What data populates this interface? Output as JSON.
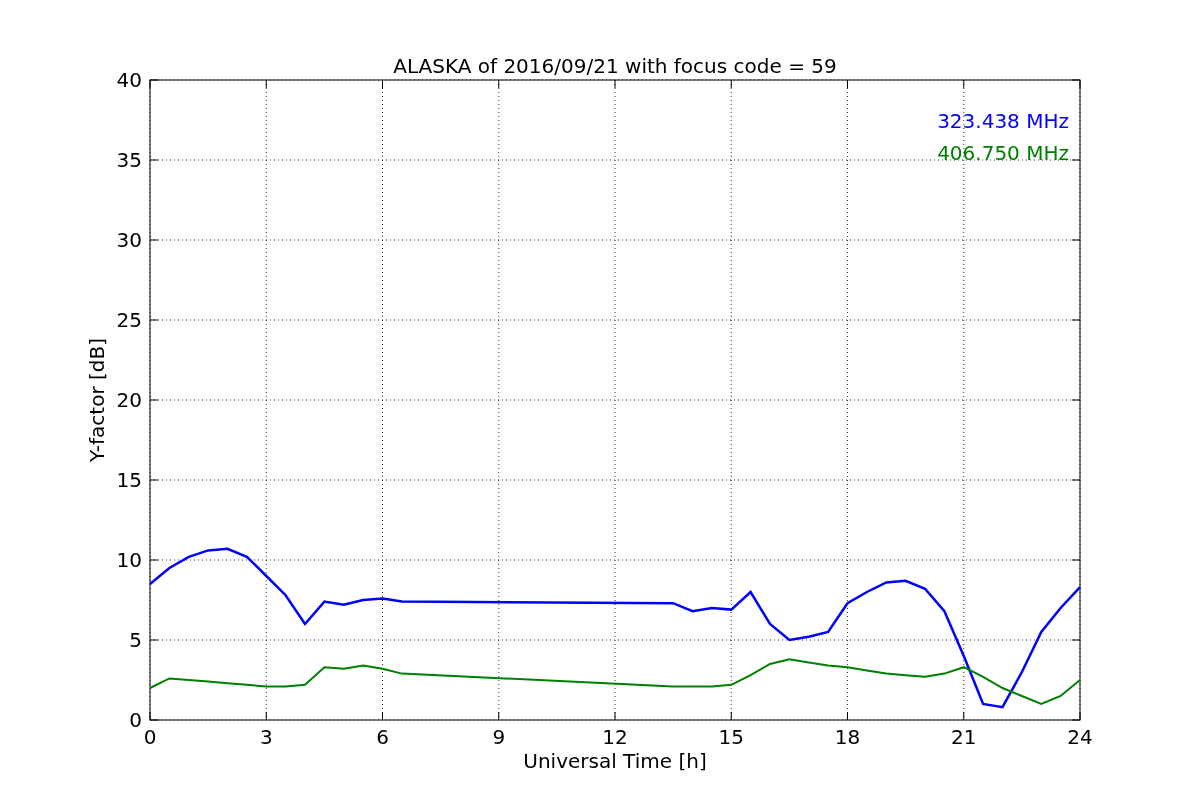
{
  "chart_data": {
    "type": "line",
    "title": "ALASKA of 2016/09/21 with focus code = 59",
    "xlabel": "Universal Time [h]",
    "ylabel": "Y-factor [dB]",
    "x": [
      0,
      0.5,
      1,
      1.5,
      2,
      2.5,
      3,
      3.5,
      4,
      4.5,
      5,
      5.5,
      6,
      6.5,
      13.5,
      14,
      14.5,
      15,
      15.5,
      16,
      16.5,
      17,
      17.5,
      18,
      18.5,
      19,
      19.5,
      20,
      20.5,
      21,
      21.5,
      22,
      22.5,
      23,
      23.5,
      24
    ],
    "series": [
      {
        "name": "323.438 MHz",
        "color": "#0000ff",
        "values": [
          8.5,
          9.5,
          10.2,
          10.6,
          10.7,
          10.2,
          9.0,
          7.8,
          6.0,
          7.4,
          7.2,
          7.5,
          7.6,
          7.4,
          7.3,
          6.8,
          7.0,
          6.9,
          8.0,
          6.0,
          5.0,
          5.2,
          5.5,
          7.3,
          8.0,
          8.6,
          8.7,
          8.2,
          6.8,
          4.0,
          1.0,
          0.8,
          3.0,
          5.5,
          7.0,
          8.3
        ]
      },
      {
        "name": "406.750 MHz",
        "color": "#008000",
        "values": [
          2.0,
          2.6,
          2.5,
          2.4,
          2.3,
          2.2,
          2.1,
          2.1,
          2.2,
          3.3,
          3.2,
          3.4,
          3.2,
          2.9,
          2.1,
          2.1,
          2.1,
          2.2,
          2.8,
          3.5,
          3.8,
          3.6,
          3.4,
          3.3,
          3.1,
          2.9,
          2.8,
          2.7,
          2.9,
          3.3,
          2.7,
          2.0,
          1.5,
          1.0,
          1.5,
          2.5
        ]
      }
    ],
    "xlim": [
      0,
      24
    ],
    "ylim": [
      0,
      40
    ],
    "xticks": [
      0,
      3,
      6,
      9,
      12,
      15,
      18,
      21,
      24
    ],
    "yticks": [
      0,
      5,
      10,
      15,
      20,
      25,
      30,
      35,
      40
    ],
    "grid": true
  }
}
